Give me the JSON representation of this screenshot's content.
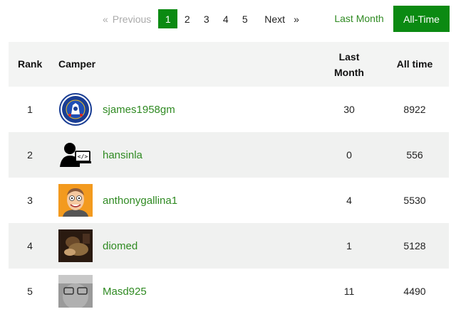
{
  "pagination": {
    "first_symbol": "«",
    "previous_label": "Previous",
    "pages": [
      "1",
      "2",
      "3",
      "4",
      "5"
    ],
    "active_page": "1",
    "next_label": "Next",
    "last_symbol": "»"
  },
  "toggles": {
    "last_month_label": "Last Month",
    "all_time_label": "All-Time",
    "active": "All-Time"
  },
  "table": {
    "headers": {
      "rank": "Rank",
      "camper": "Camper",
      "last_month_line1": "Last",
      "last_month_line2": "Month",
      "all_time": "All time"
    },
    "rows": [
      {
        "rank": "1",
        "name": "sjames1958gm",
        "last_month": "30",
        "all_time": "8922",
        "avatar": "chelsea-crest-avatar"
      },
      {
        "rank": "2",
        "name": "hansinla",
        "last_month": "0",
        "all_time": "556",
        "avatar": "coder-silhouette-avatar"
      },
      {
        "rank": "3",
        "name": "anthonygallina1",
        "last_month": "4",
        "all_time": "5530",
        "avatar": "cartoon-face-avatar"
      },
      {
        "rank": "4",
        "name": "diomed",
        "last_month": "1",
        "all_time": "5128",
        "avatar": "painting-avatar"
      },
      {
        "rank": "5",
        "name": "Masd925",
        "last_month": "11",
        "all_time": "4490",
        "avatar": "photo-avatar"
      }
    ]
  },
  "colors": {
    "accent_green": "#0b8a12",
    "link_green": "#2f8a22",
    "row_alt": "#f0f1f0"
  }
}
